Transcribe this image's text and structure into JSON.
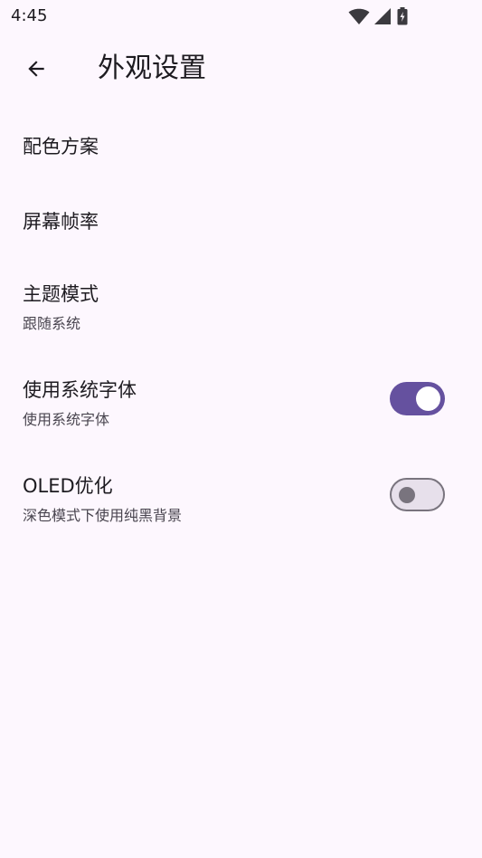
{
  "status_bar": {
    "time": "4:45",
    "icons": [
      "wifi-icon",
      "cellular-signal-icon",
      "battery-charging-icon"
    ]
  },
  "app_bar": {
    "back_icon": "arrow-back-icon",
    "title": "外观设置"
  },
  "settings": {
    "color_scheme": {
      "title": "配色方案"
    },
    "refresh_rate": {
      "title": "屏幕帧率"
    },
    "theme_mode": {
      "title": "主题模式",
      "subtitle": "跟随系统"
    },
    "system_font": {
      "title": "使用系统字体",
      "subtitle": "使用系统字体",
      "enabled": true
    },
    "oled": {
      "title": "OLED优化",
      "subtitle": "深色模式下使用纯黑背景",
      "enabled": false
    }
  },
  "colors": {
    "background": "#FDF7FE",
    "switch_on": "#65519F",
    "switch_off_track": "#E7E0EB",
    "switch_off_outline": "#79747E"
  }
}
